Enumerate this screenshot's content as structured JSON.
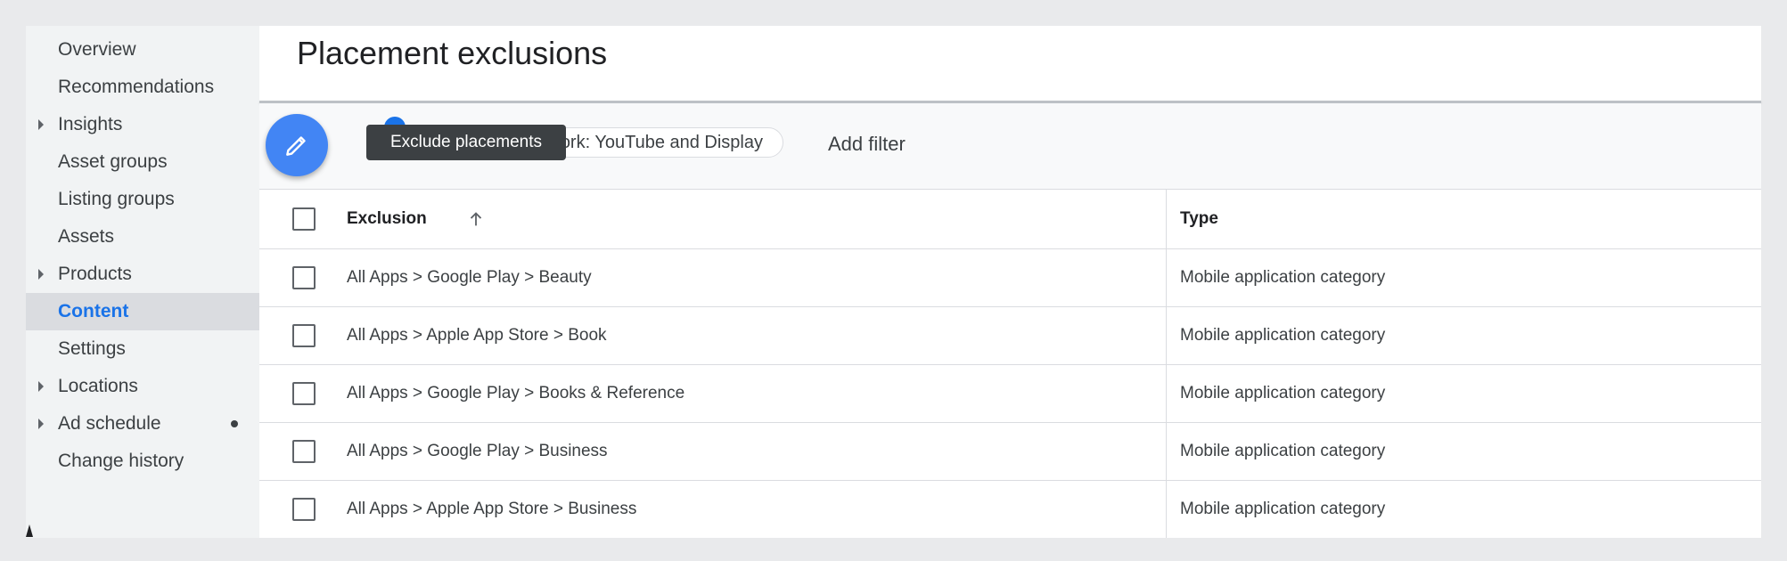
{
  "sidebar": {
    "items": [
      {
        "label": "Overview",
        "has_caret": false,
        "active": false
      },
      {
        "label": "Recommendations",
        "has_caret": false,
        "active": false
      },
      {
        "label": "Insights",
        "has_caret": true,
        "active": false
      },
      {
        "label": "Asset groups",
        "has_caret": false,
        "active": false
      },
      {
        "label": "Listing groups",
        "has_caret": false,
        "active": false
      },
      {
        "label": "Assets",
        "has_caret": false,
        "active": false
      },
      {
        "label": "Products",
        "has_caret": true,
        "active": false
      },
      {
        "label": "Content",
        "has_caret": false,
        "active": true
      },
      {
        "label": "Settings",
        "has_caret": false,
        "active": false
      },
      {
        "label": "Locations",
        "has_caret": true,
        "active": false
      },
      {
        "label": "Ad schedule",
        "has_caret": true,
        "active": false,
        "dot": true
      },
      {
        "label": "Change history",
        "has_caret": false,
        "active": false
      }
    ]
  },
  "header": {
    "title": "Placement exclusions"
  },
  "toolbar": {
    "fab_icon": "pencil-icon",
    "tooltip": "Exclude placements",
    "filter_chip": "ork: YouTube and Display",
    "add_filter": "Add filter"
  },
  "table": {
    "columns": {
      "exclusion": "Exclusion",
      "type": "Type",
      "sort_icon": "arrow-up-icon"
    },
    "rows": [
      {
        "exclusion": "All Apps > Google Play > Beauty",
        "type": "Mobile application category"
      },
      {
        "exclusion": "All Apps > Apple App Store > Book",
        "type": "Mobile application category"
      },
      {
        "exclusion": "All Apps > Google Play > Books & Reference",
        "type": "Mobile application category"
      },
      {
        "exclusion": "All Apps > Google Play > Business",
        "type": "Mobile application category"
      },
      {
        "exclusion": "All Apps > Apple App Store > Business",
        "type": "Mobile application category"
      }
    ]
  },
  "colors": {
    "accent": "#1a73e8",
    "fab": "#4285f4",
    "tooltip_bg": "#3c4043"
  }
}
